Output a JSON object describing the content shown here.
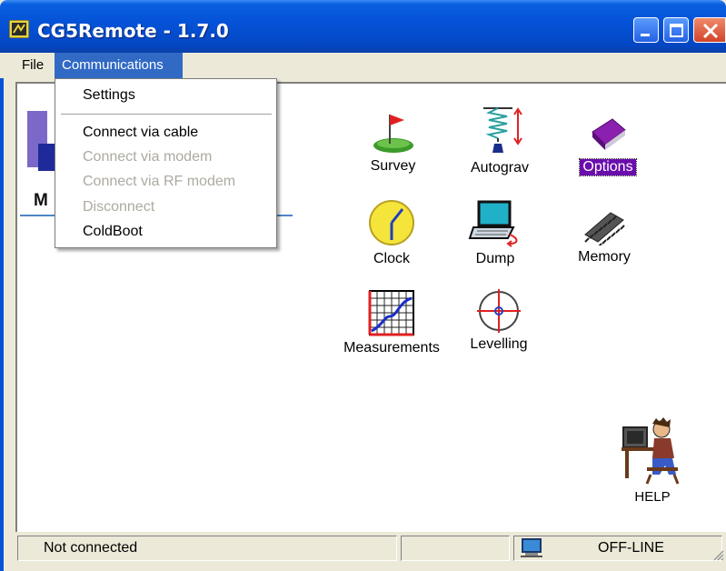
{
  "window": {
    "title": "CG5Remote - 1.7.0"
  },
  "menubar": {
    "file": "File",
    "communications": "Communications"
  },
  "dropdown": {
    "items": [
      {
        "label": "Settings",
        "enabled": true
      },
      {
        "label": "Connect via cable",
        "enabled": true
      },
      {
        "label": "Connect via modem",
        "enabled": false
      },
      {
        "label": "Connect via RF modem",
        "enabled": false
      },
      {
        "label": "Disconnect",
        "enabled": false
      },
      {
        "label": "ColdBoot",
        "enabled": true
      }
    ]
  },
  "tools": {
    "survey": "Survey",
    "autograv": "Autograv",
    "options": "Options",
    "clock": "Clock",
    "dump": "Dump",
    "memory": "Memory",
    "measurements": "Measurements",
    "levelling": "Levelling",
    "help": "HELP"
  },
  "logo": {
    "letter": "M"
  },
  "status": {
    "connection": "Not connected",
    "mode": "OFF-LINE"
  },
  "colors": {
    "titlebar": "#0553d8",
    "menu_highlight": "#316ac5",
    "selected_label": "#6a0dad",
    "disabled_text": "#acaaa0"
  }
}
